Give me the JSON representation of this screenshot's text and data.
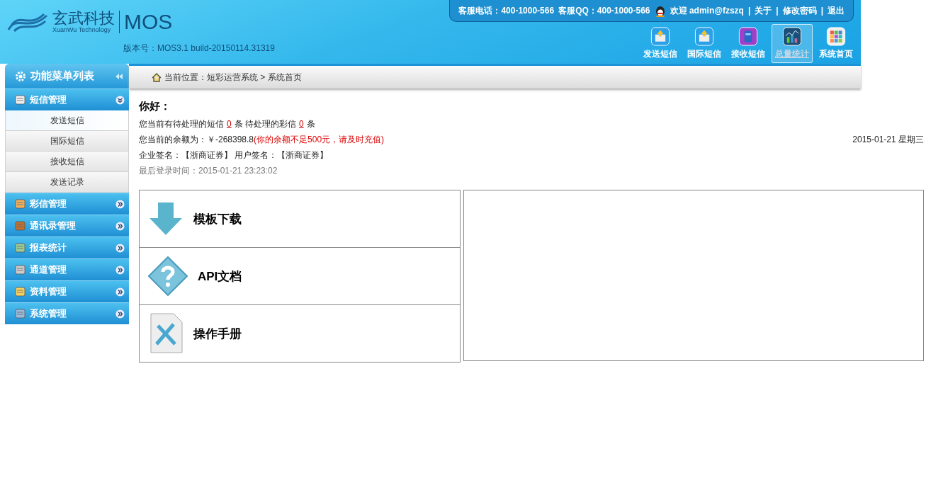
{
  "header": {
    "company": "玄武科技",
    "company_en": "XuanWu Technology",
    "product": "MOS",
    "version": "版本号：MOS3.1 build-20150114.31319"
  },
  "top_bar": {
    "items": [
      "客服电话：400-1000-566",
      "客服QQ：400-1000-566"
    ],
    "welcome": "欢迎 admin@fzszq",
    "separator": "|",
    "links": [
      "关于",
      "修改密码",
      "退出"
    ]
  },
  "nav": [
    {
      "label": "发送短信",
      "kind": "send",
      "selected": false
    },
    {
      "label": "国际短信",
      "kind": "send",
      "selected": false
    },
    {
      "label": "接收短信",
      "kind": "mailbox",
      "selected": false
    },
    {
      "label": "总量统计",
      "kind": "chart",
      "selected": true
    },
    {
      "label": "系统首页",
      "kind": "grid",
      "selected": false
    }
  ],
  "sidebar": {
    "title": "功能菜单列表",
    "groups": [
      {
        "label": "短信管理",
        "kind": "sms",
        "expanded": true,
        "children": [
          {
            "label": "发送短信",
            "selected": true
          },
          {
            "label": "国际短信",
            "selected": false
          },
          {
            "label": "接收短信",
            "selected": false
          },
          {
            "label": "发送记录",
            "selected": false
          }
        ]
      },
      {
        "label": "彩信管理",
        "kind": "mms",
        "expanded": false
      },
      {
        "label": "通讯录管理",
        "kind": "book",
        "expanded": false
      },
      {
        "label": "报表统计",
        "kind": "report",
        "expanded": false
      },
      {
        "label": "通道管理",
        "kind": "channel",
        "expanded": false
      },
      {
        "label": "资料管理",
        "kind": "folder",
        "expanded": false
      },
      {
        "label": "系统管理",
        "kind": "computer",
        "expanded": false
      }
    ]
  },
  "breadcrumb": "当前位置：短彩运营系统 > 系统首页",
  "greeting": "你好：",
  "pending": {
    "parts": [
      "您当前有待处理的短信",
      "0",
      "条 待处理的彩信",
      "0",
      "条"
    ]
  },
  "balance": {
    "label": "您当前的余额为：￥-268398.8",
    "warning": "(你的余额不足500元，请及时充值)"
  },
  "date": "2015-01-21 星期三",
  "signatures": "企业签名：【浙商证券】 用户签名：【浙商证券】",
  "last_login": "最后登录时间：2015-01-21 23:23:02",
  "cards": [
    {
      "label": "模板下载",
      "kind": "download"
    },
    {
      "label": "API文档",
      "kind": "help"
    },
    {
      "label": "操作手册",
      "kind": "manual"
    }
  ]
}
